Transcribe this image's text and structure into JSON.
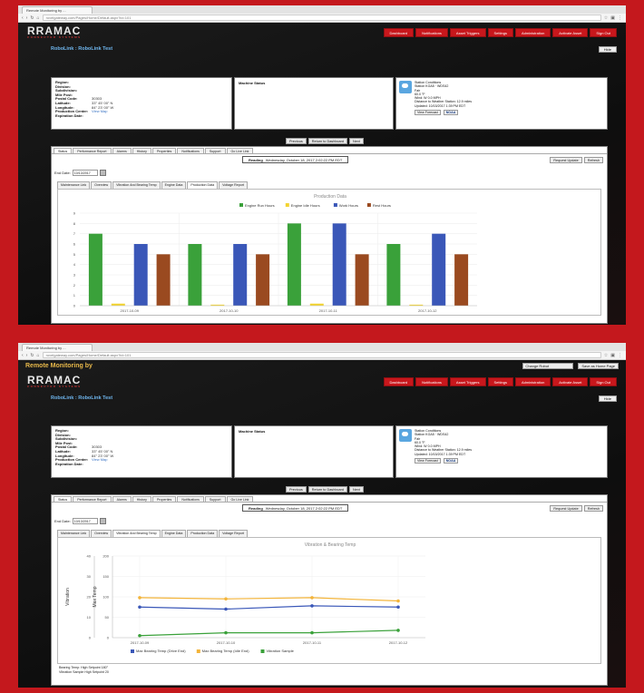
{
  "screens": [
    {
      "browser": {
        "tab_title": "Remote Monitoring by ...",
        "url": "rovelgateway.com/Pages/Home/Default.aspx?id=101"
      },
      "app": {
        "remote_title": "",
        "logo_text": "RRAMAC",
        "logo_sub": "CONNECTED SYSTEMS"
      },
      "nav": [
        "Dashboard",
        "Notifications",
        "Asset Triggers",
        "Settings",
        "Administration",
        "Activate Asset",
        "Sign Out"
      ],
      "robolink_title": "RoboLink : RoboLink Test",
      "hide_label": "Hide",
      "site_info": [
        {
          "k": "Region:",
          "v": ""
        },
        {
          "k": "Division:",
          "v": ""
        },
        {
          "k": "Subdivision:",
          "v": ""
        },
        {
          "k": "Mile Post:",
          "v": ""
        },
        {
          "k": "Postal Code:",
          "v": "30303"
        },
        {
          "k": "Latitude:",
          "v": "33° 45' 00\" N"
        },
        {
          "k": "Longitude:",
          "v": "84° 23' 00\" W"
        },
        {
          "k": "Production Center:",
          "v": "View Map"
        },
        {
          "k": "Expiration Date:",
          "v": ""
        }
      ],
      "machine_status_label": "Machine Status",
      "weather": [
        "Station Conditions",
        "Station KGA5 · WDS42",
        "Fair",
        "60.0 °F",
        "Wind: W 0.0 MPH",
        "Distance to Weather Station: 12.9 miles",
        "Updated: 10/15/2017 1:39 PM EDT"
      ],
      "view_forecast": "View Forecast",
      "noaa": "NOAA",
      "buttons": [
        "Previous",
        "Return to Dashboard",
        "Next"
      ],
      "tabs": [
        "Status",
        "Performance Report",
        "Alarms",
        "History",
        "Properties",
        "Notifications",
        "Support",
        "Go Live Link"
      ],
      "reading_label": "Reading",
      "reading_value": "Wednesday, October 18, 2017 2:02:22 PM EDT",
      "request_update": "Request Update",
      "refresh": "Refresh",
      "end_date_label": "End Date:",
      "end_date_value": "10/13/2017",
      "subtabs": [
        "Maintenance Link",
        "Overview",
        "Vibration And Bearing Temp",
        "Engine Data",
        "Production Data",
        "Voltage Report"
      ],
      "active_subtab": 4,
      "footnotes": [],
      "chart_data": {
        "type": "bar",
        "title": "Production Data",
        "categories": [
          "2017-10-09",
          "2017-10-10",
          "2017-10-11",
          "2017-10-12"
        ],
        "series": [
          {
            "name": "Engine Run Hours",
            "color": "#3aa13a",
            "values": [
              7,
              6,
              8,
              6
            ]
          },
          {
            "name": "Engine Idle Hours",
            "color": "#f3d430",
            "values": [
              0.2,
              0.1,
              0.2,
              0.1
            ]
          },
          {
            "name": "Work Hours",
            "color": "#3a57b8",
            "values": [
              6,
              6,
              8,
              7
            ]
          },
          {
            "name": "Rest Hours",
            "color": "#9a4a20",
            "values": [
              5,
              5,
              5,
              5
            ]
          }
        ],
        "ylim": [
          0,
          9
        ],
        "yticks": [
          0,
          1,
          2,
          3,
          4,
          5,
          6,
          7,
          8,
          9
        ]
      }
    },
    {
      "browser": {
        "tab_title": "Remote Monitoring by ...",
        "url": "rovelgateway.com/Pages/Home/Default.aspx?id=101"
      },
      "app": {
        "remote_title": "Remote Monitoring by",
        "logo_text": "RRAMAC",
        "logo_sub": "CONNECTED SYSTEMS",
        "select_label": "Change Robot",
        "secondary_button": "Save as Home Page"
      },
      "nav": [
        "Dashboard",
        "Notifications",
        "Asset Triggers",
        "Settings",
        "Administration",
        "Activate Asset",
        "Sign Out"
      ],
      "robolink_title": "RoboLink : RoboLink Test",
      "hide_label": "Hide",
      "site_info": [
        {
          "k": "Region:",
          "v": ""
        },
        {
          "k": "Division:",
          "v": ""
        },
        {
          "k": "Subdivision:",
          "v": ""
        },
        {
          "k": "Mile Post:",
          "v": ""
        },
        {
          "k": "Postal Code:",
          "v": "30303"
        },
        {
          "k": "Latitude:",
          "v": "33° 45' 00\" N"
        },
        {
          "k": "Longitude:",
          "v": "84° 23' 00\" W"
        },
        {
          "k": "Production Center:",
          "v": "View Map"
        },
        {
          "k": "Expiration Date:",
          "v": ""
        }
      ],
      "machine_status_label": "Machine Status",
      "weather": [
        "Station Conditions",
        "Station KGA5 · WDS42",
        "Fair",
        "60.0 °F",
        "Wind: W 0.0 MPH",
        "Distance to Weather Station: 12.9 miles",
        "Updated: 10/15/2017 1:39 PM EDT"
      ],
      "view_forecast": "View Forecast",
      "noaa": "NOAA",
      "buttons": [
        "Previous",
        "Return to Dashboard",
        "Next"
      ],
      "tabs": [
        "Status",
        "Performance Report",
        "Alarms",
        "History",
        "Properties",
        "Notifications",
        "Support",
        "Go Live Link"
      ],
      "reading_label": "Reading",
      "reading_value": "Wednesday, October 18, 2017 2:02:22 PM EDT",
      "request_update": "Request Update",
      "refresh": "Refresh",
      "end_date_label": "End Date:",
      "end_date_value": "10/13/2017",
      "subtabs": [
        "Maintenance Link",
        "Overview",
        "Vibration And Bearing Temp",
        "Engine Data",
        "Production Data",
        "Voltage Report"
      ],
      "active_subtab": 2,
      "footnotes": [
        "Bearing Temp: High Setpoint 180°",
        "Vibration Sample High Setpoint 20"
      ],
      "chart_data": {
        "type": "line",
        "title": "Vibration & Bearing Temp",
        "categories": [
          "2017-10-09",
          "2017-10-10",
          "2017-10-11",
          "2017-10-12"
        ],
        "ylabel": "Vibration",
        "ylabel2": "Max Temp",
        "ylim": [
          0,
          200
        ],
        "yticks": [
          0,
          50,
          100,
          150,
          200
        ],
        "yticks_left": [
          0,
          10,
          20,
          30,
          40
        ],
        "series": [
          {
            "name": "Max Bearing Temp (Drive End)",
            "color": "#3a57b8",
            "values": [
              75,
              70,
              78,
              75
            ]
          },
          {
            "name": "Max Bearing Temp (Idle End)",
            "color": "#f3b43a",
            "values": [
              98,
              95,
              98,
              90
            ]
          },
          {
            "name": "Vibration Sample",
            "color": "#3aa13a",
            "values": [
              5,
              12,
              12,
              18
            ]
          }
        ]
      }
    }
  ]
}
